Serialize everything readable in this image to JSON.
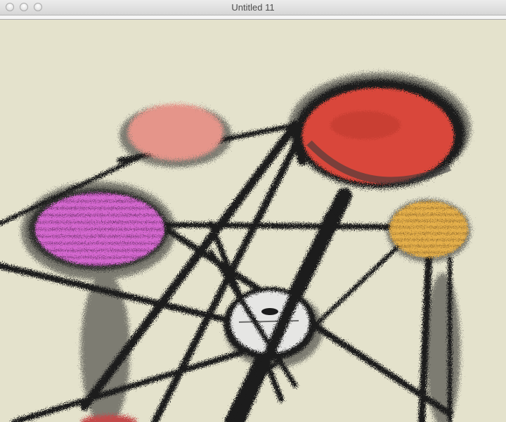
{
  "window": {
    "title": "Untitled 11"
  },
  "canvas": {
    "background": "#e4e2cc",
    "scene": "ferris-wheel",
    "frame_color": "#1c1c1c",
    "gondolas": [
      {
        "name": "pink-gondola",
        "color": "#e5958a"
      },
      {
        "name": "magenta-gondola",
        "color": "#e06ad9"
      },
      {
        "name": "red-gondola",
        "color": "#d9473a"
      },
      {
        "name": "yellow-gondola",
        "color": "#e5b04c"
      },
      {
        "name": "white-gondola",
        "color": "#e6e6e4"
      },
      {
        "name": "bottom-red-gondola",
        "color": "#c24a4a"
      }
    ]
  }
}
